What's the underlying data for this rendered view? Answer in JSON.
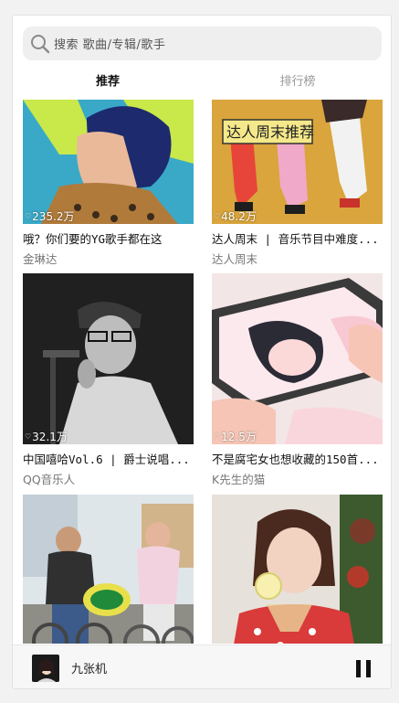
{
  "search": {
    "placeholder": "搜索 歌曲/专辑/歌手",
    "icon": "search-icon"
  },
  "tabs": [
    {
      "label": "推荐",
      "active": true
    },
    {
      "label": "排行榜",
      "active": false
    }
  ],
  "playlists": [
    {
      "title": "哦？你们要的YG歌手都在这",
      "author": "金琳达",
      "plays": "235.2万"
    },
    {
      "title": "达人周末 | 音乐节目中难度...",
      "author": "达人周末",
      "plays": "48.2万",
      "cover_text": "达人周末推荐"
    },
    {
      "title": "中国嘻哈Vol.6 | 爵士说唱...",
      "author": "QQ音乐人",
      "plays": "32.1万"
    },
    {
      "title": "不是腐宅女也想收藏的150首...",
      "author": "K先生的猫",
      "plays": "12.5万"
    },
    {
      "title": "",
      "author": "",
      "plays": ""
    },
    {
      "title": "",
      "author": "",
      "plays": ""
    }
  ],
  "player": {
    "song": "九张机",
    "state": "playing",
    "control": "pause-icon"
  }
}
